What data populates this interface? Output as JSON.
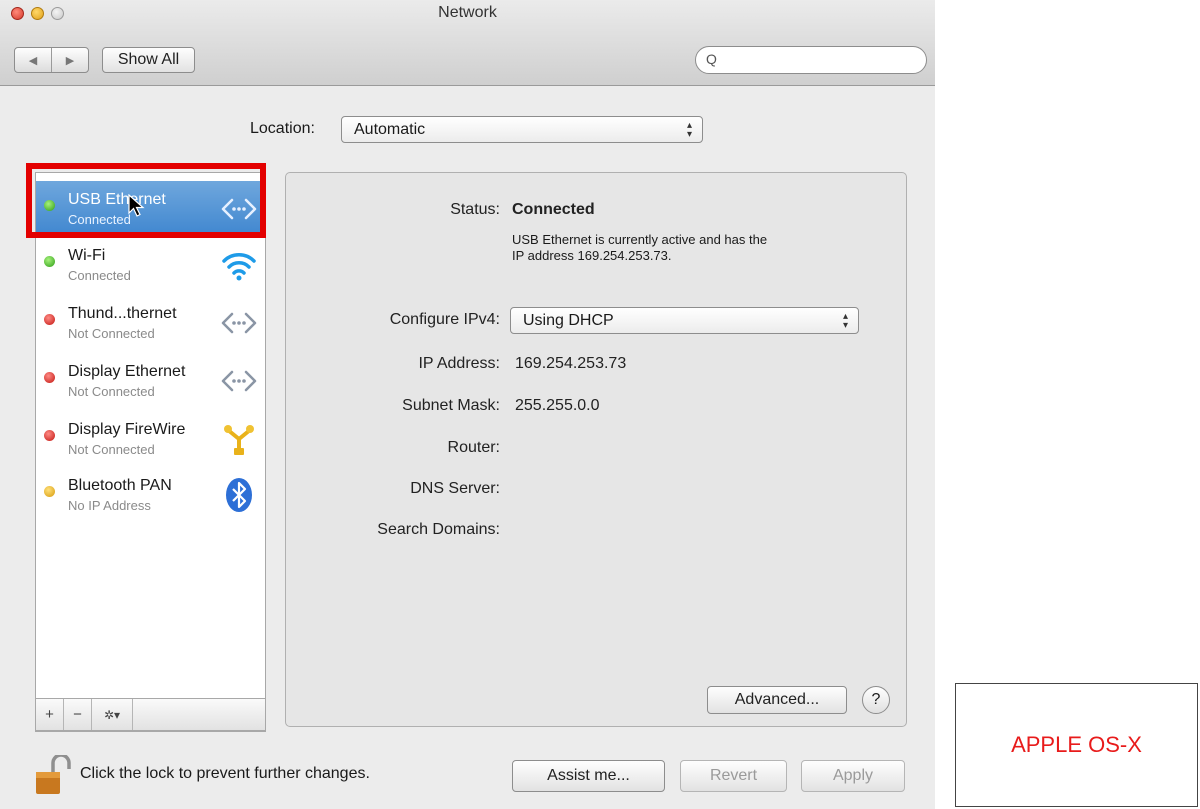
{
  "window": {
    "title": "Network"
  },
  "toolbar": {
    "back_glyph": "◀",
    "forward_glyph": "▶",
    "show_all_label": "Show All",
    "search_placeholder": "",
    "search_glyph": "Q"
  },
  "location": {
    "label": "Location:",
    "value": "Automatic"
  },
  "services": [
    {
      "name": "USB Ethernet",
      "status": "Connected",
      "status_color": "green",
      "icon": "ethernet-arrows-icon",
      "selected": true
    },
    {
      "name": "Wi-Fi",
      "status": "Connected",
      "status_color": "green",
      "icon": "wifi-icon",
      "selected": false
    },
    {
      "name": "Thund...thernet",
      "status": "Not Connected",
      "status_color": "red",
      "icon": "ethernet-arrows-icon",
      "selected": false
    },
    {
      "name": "Display Ethernet",
      "status": "Not Connected",
      "status_color": "red",
      "icon": "ethernet-arrows-icon",
      "selected": false
    },
    {
      "name": "Display FireWire",
      "status": "Not Connected",
      "status_color": "red",
      "icon": "firewire-icon",
      "selected": false
    },
    {
      "name": "Bluetooth PAN",
      "status": "No IP Address",
      "status_color": "yellow",
      "icon": "bluetooth-icon",
      "selected": false
    }
  ],
  "sidebar_actions": {
    "add": "+",
    "remove": "−",
    "gear": "✲▾"
  },
  "details": {
    "status_label": "Status:",
    "status_value": "Connected",
    "status_desc_line1": "USB Ethernet is currently active and has the",
    "status_desc_line2": "IP address 169.254.253.73.",
    "configure_label": "Configure IPv4:",
    "configure_value": "Using DHCP",
    "ip_label": "IP Address:",
    "ip_value": "169.254.253.73",
    "subnet_label": "Subnet Mask:",
    "subnet_value": "255.255.0.0",
    "router_label": "Router:",
    "router_value": "",
    "dns_label": "DNS Server:",
    "dns_value": "",
    "search_domains_label": "Search Domains:",
    "search_domains_value": "",
    "advanced_label": "Advanced...",
    "help_label": "?"
  },
  "footer": {
    "lock_text": "Click the lock to prevent further changes.",
    "assist_label": "Assist me...",
    "revert_label": "Revert",
    "apply_label": "Apply"
  },
  "caption": {
    "text": "APPLE OS-X"
  },
  "colors": {
    "highlight_box": "#e30000",
    "selection": "#3f86cf",
    "caption_text": "#e81b1b"
  }
}
